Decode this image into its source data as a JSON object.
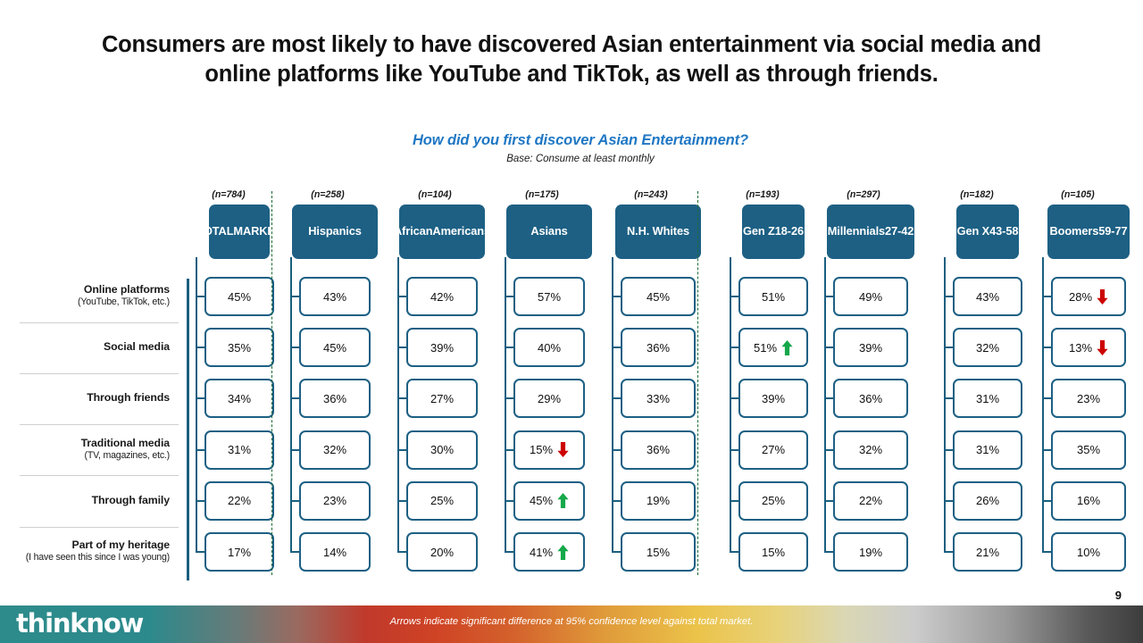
{
  "slide": {
    "title": "Consumers are most likely to have discovered Asian entertainment via social media and online platforms like YouTube and TikTok, as well as through friends.",
    "question": "How did you first discover Asian Entertainment?",
    "base": "Base: Consume at least monthly",
    "page_number": "9",
    "logo": "thinknow",
    "footnote": "Arrows indicate significant difference at 95% confidence level against total market.",
    "colors": {
      "header_blue": "#1D6084",
      "question_blue": "#1F77C4",
      "up_arrow_green": "#16a84a",
      "down_arrow_red": "#cc0000",
      "divider_green": "#1d6b33",
      "connector_blue": "#1a5f80"
    }
  },
  "chart_data": {
    "type": "table",
    "title": "How did you first discover Asian Entertainment?",
    "subtitle": "Base: Consume at least monthly",
    "note": "Arrows indicate significant difference at 95% confidence level against total market.",
    "row_header_label": "",
    "categories": [
      {
        "main": "Online platforms",
        "sub": "(YouTube, TikTok, etc.)"
      },
      {
        "main": "Social media",
        "sub": ""
      },
      {
        "main": "Through friends",
        "sub": ""
      },
      {
        "main": "Traditional media",
        "sub": "(TV, magazines, etc.)"
      },
      {
        "main": "Through family",
        "sub": ""
      },
      {
        "main": "Part of my heritage",
        "sub": "(I have seen this since I was young)"
      }
    ],
    "columns": [
      {
        "label": "TOTAL\nMARKET",
        "label_lines": [
          "TOTAL",
          "MARKET"
        ],
        "n": "(n=784)",
        "n_value": 784,
        "values": [
          "45%",
          "35%",
          "34%",
          "31%",
          "22%",
          "17%"
        ],
        "numeric": [
          45,
          35,
          34,
          31,
          22,
          17
        ],
        "arrows": [
          "",
          "",
          "",
          "",
          "",
          ""
        ]
      },
      {
        "label": "Hispanics",
        "label_lines": [
          "Hispanics"
        ],
        "n": "(n=258)",
        "n_value": 258,
        "values": [
          "43%",
          "45%",
          "36%",
          "32%",
          "23%",
          "14%"
        ],
        "numeric": [
          43,
          45,
          36,
          32,
          23,
          14
        ],
        "arrows": [
          "",
          "",
          "",
          "",
          "",
          ""
        ]
      },
      {
        "label": "African Americans",
        "label_lines": [
          "African",
          "Americans"
        ],
        "n": "(n=104)",
        "n_value": 104,
        "values": [
          "42%",
          "39%",
          "27%",
          "30%",
          "25%",
          "20%"
        ],
        "numeric": [
          42,
          39,
          27,
          30,
          25,
          20
        ],
        "arrows": [
          "",
          "",
          "",
          "",
          "",
          ""
        ]
      },
      {
        "label": "Asians",
        "label_lines": [
          "Asians"
        ],
        "n": "(n=175)",
        "n_value": 175,
        "values": [
          "57%",
          "40%",
          "29%",
          "15%",
          "45%",
          "41%"
        ],
        "numeric": [
          57,
          40,
          29,
          15,
          45,
          41
        ],
        "arrows": [
          "",
          "",
          "",
          "down",
          "up",
          "up"
        ]
      },
      {
        "label": "N.H. Whites",
        "label_lines": [
          "N.H. Whites"
        ],
        "n": "(n=243)",
        "n_value": 243,
        "values": [
          "45%",
          "36%",
          "33%",
          "36%",
          "19%",
          "15%"
        ],
        "numeric": [
          45,
          36,
          33,
          36,
          19,
          15
        ],
        "arrows": [
          "",
          "",
          "",
          "",
          "",
          ""
        ]
      },
      {
        "label": "Gen Z 18-26",
        "label_lines": [
          "Gen Z",
          "18-26"
        ],
        "n": "(n=193)",
        "n_value": 193,
        "values": [
          "51%",
          "51%",
          "39%",
          "27%",
          "25%",
          "15%"
        ],
        "numeric": [
          51,
          51,
          39,
          27,
          25,
          15
        ],
        "arrows": [
          "",
          "up",
          "",
          "",
          "",
          ""
        ]
      },
      {
        "label": "Millennials 27-42",
        "label_lines": [
          "Millennials",
          "27-42"
        ],
        "n": "(n=297)",
        "n_value": 297,
        "values": [
          "49%",
          "39%",
          "36%",
          "32%",
          "22%",
          "19%"
        ],
        "numeric": [
          49,
          39,
          36,
          32,
          22,
          19
        ],
        "arrows": [
          "",
          "",
          "",
          "",
          "",
          ""
        ]
      },
      {
        "label": "Gen X 43-58",
        "label_lines": [
          "Gen X",
          "43-58"
        ],
        "n": "(n=182)",
        "n_value": 182,
        "values": [
          "43%",
          "32%",
          "31%",
          "31%",
          "26%",
          "21%"
        ],
        "numeric": [
          43,
          32,
          31,
          31,
          26,
          21
        ],
        "arrows": [
          "",
          "",
          "",
          "",
          "",
          ""
        ]
      },
      {
        "label": "Boomers 59-77",
        "label_lines": [
          "Boomers",
          "59-77"
        ],
        "n": "(n=105)",
        "n_value": 105,
        "values": [
          "28%",
          "13%",
          "23%",
          "35%",
          "16%",
          "10%"
        ],
        "numeric": [
          28,
          13,
          23,
          35,
          16,
          10
        ],
        "arrows": [
          "down",
          "down",
          "",
          "",
          "",
          ""
        ]
      }
    ]
  }
}
